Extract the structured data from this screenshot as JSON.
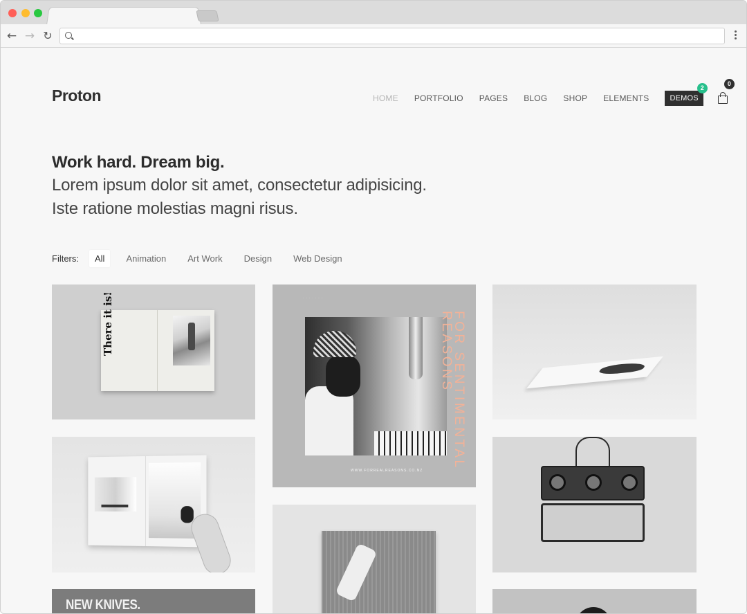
{
  "browser": {
    "url": ""
  },
  "site": {
    "logo": "Proton",
    "nav": [
      "HOME",
      "PORTFOLIO",
      "PAGES",
      "BLOG",
      "SHOP",
      "ELEMENTS"
    ],
    "demos_label": "DEMOS",
    "demos_badge": "2",
    "cart_count": "0"
  },
  "hero": {
    "title": "Work hard. Dream big.",
    "line1": "Lorem ipsum dolor sit amet, consectetur adipisicing.",
    "line2": "Iste ratione molestias magni risus."
  },
  "filters": {
    "label": "Filters:",
    "items": [
      "All",
      "Animation",
      "Art Work",
      "Design",
      "Web Design"
    ],
    "active": "All"
  },
  "portfolio": {
    "book_text": "There it is!",
    "poster_title_1": "FOR SENTIMENTAL",
    "poster_title_2": "REASONS",
    "poster_url": "WWW.FORREALREASONS.CO.NZ",
    "card7_title": "NEW KNIVES."
  },
  "colors": {
    "accent_badge": "#27c08c",
    "demos_bg": "#303030",
    "poster_text": "#f2b298"
  }
}
